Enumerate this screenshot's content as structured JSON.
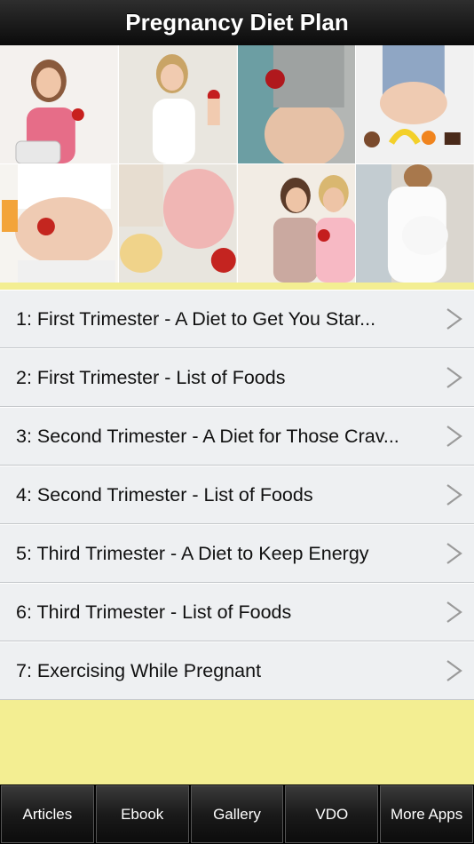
{
  "header": {
    "title": "Pregnancy Diet Plan"
  },
  "banner": {
    "tiles": [
      {
        "name": "woman-with-apple-and-scale"
      },
      {
        "name": "pregnant-woman-holding-apple"
      },
      {
        "name": "pregnant-belly-with-apple"
      },
      {
        "name": "belly-with-fruits-and-cakes"
      },
      {
        "name": "belly-with-apple-and-juice"
      },
      {
        "name": "chips-and-apple"
      },
      {
        "name": "two-women-with-apples"
      },
      {
        "name": "pregnant-woman-white-top"
      }
    ]
  },
  "list": {
    "items": [
      {
        "label": "1: First Trimester - A Diet to Get You Star..."
      },
      {
        "label": "2: First Trimester - List of Foods"
      },
      {
        "label": "3: Second Trimester - A Diet for Those Crav..."
      },
      {
        "label": "4: Second Trimester - List of Foods"
      },
      {
        "label": "5: Third Trimester - A Diet to Keep Energy"
      },
      {
        "label": "6: Third Trimester - List of Foods"
      },
      {
        "label": "7: Exercising While Pregnant"
      }
    ]
  },
  "tabbar": {
    "tabs": [
      {
        "label": "Articles"
      },
      {
        "label": "Ebook"
      },
      {
        "label": "Gallery"
      },
      {
        "label": "VDO"
      },
      {
        "label": "More Apps"
      }
    ]
  },
  "colors": {
    "background": "#f3ee92",
    "row": "#eef0f2",
    "navbar": "#1a1a1a"
  }
}
